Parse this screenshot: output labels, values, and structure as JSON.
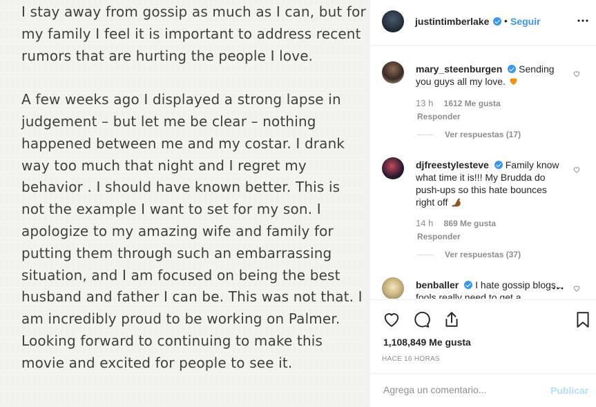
{
  "post": {
    "note_paragraphs": [
      "I stay away from gossip as much as I can, but for my family I feel it is important to address recent rumors that are hurting the people I love.",
      "A few weeks ago I displayed a strong lapse in judgement – but let me be clear – nothing happened between me and my costar. I drank way too much that night and I regret my behavior . I should have known better. This is not the example I want to set for my son. I apologize to my amazing wife and family for putting them through such an embarrassing situation, and I am focused on being the best husband and father I can be. This was not that. I am incredibly proud to be working on Palmer. Looking forward to continuing to make this movie and excited for people to see it."
    ]
  },
  "header": {
    "username": "justintimberlake",
    "separator": "•",
    "follow_label": "Seguir",
    "more_icon": "more-horizontal-icon"
  },
  "comments": [
    {
      "username": "mary_steenburgen",
      "text": "Sending you guys all my love. ",
      "emoji": "orange-heart",
      "time": "13 h",
      "likes": "1612 Me gusta",
      "reply": "Responder",
      "view_replies": "Ver respuestas (17)"
    },
    {
      "username": "djfreestylesteve",
      "text": "Family know what time it is!!! My Brudda do push-ups so this hate bounces right off ",
      "emoji": "flexed-biceps",
      "time": "14 h",
      "likes": "869 Me gusta",
      "reply": "Responder",
      "view_replies": "Ver respuestas (37)"
    },
    {
      "username": "benballer",
      "text": "I hate gossip blogs.. fools really need to get a"
    }
  ],
  "actions": {
    "icons": [
      "heart-icon",
      "comment-icon",
      "share-icon",
      "bookmark-icon"
    ],
    "likes_count": "1,108,849 Me gusta",
    "time_ago": "HACE 16 HORAS"
  },
  "add_comment": {
    "placeholder": "Agrega un comentario...",
    "publish_label": "Publicar"
  },
  "colors": {
    "link_blue": "#3897f0",
    "publish_disabled": "#b2dffc",
    "muted_text": "#8e8e8e",
    "note_background": "#f4f4f2"
  }
}
